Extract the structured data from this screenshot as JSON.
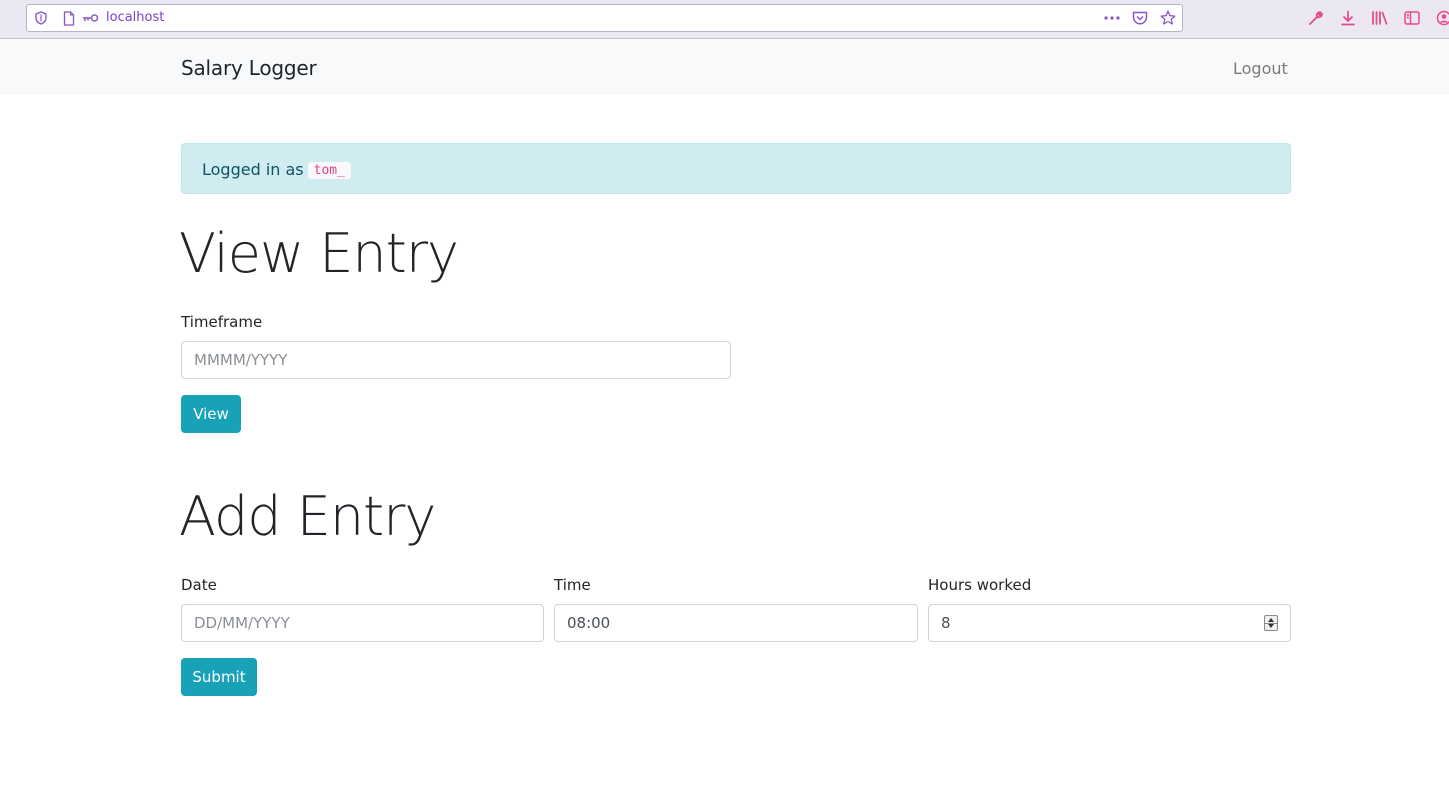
{
  "browser": {
    "url": "localhost",
    "icons": [
      "shield-icon",
      "page-icon",
      "key-icon",
      "more-icon",
      "pocket-icon",
      "star-icon",
      "wrench-icon",
      "download-icon",
      "library-icon",
      "sidebar-icon",
      "account-icon"
    ]
  },
  "navbar": {
    "brand": "Salary Logger",
    "logout": "Logout"
  },
  "alert": {
    "text": "Logged in as",
    "username": "tom_"
  },
  "view_entry": {
    "heading": "View Entry",
    "timeframe_label": "Timeframe",
    "timeframe_placeholder": "MMMM/YYYY",
    "view_button": "View"
  },
  "add_entry": {
    "heading": "Add Entry",
    "date_label": "Date",
    "date_placeholder": "DD/MM/YYYY",
    "time_label": "Time",
    "time_value": "08:00",
    "hours_label": "Hours worked",
    "hours_value": "8",
    "submit_button": "Submit"
  },
  "colors": {
    "accent": "#17a2b8",
    "alert_bg": "#d1ecf1",
    "alert_text": "#0c5460",
    "code": "#e83e8c",
    "browser_purple": "#7c3fcf",
    "browser_pink": "#e8488a"
  }
}
